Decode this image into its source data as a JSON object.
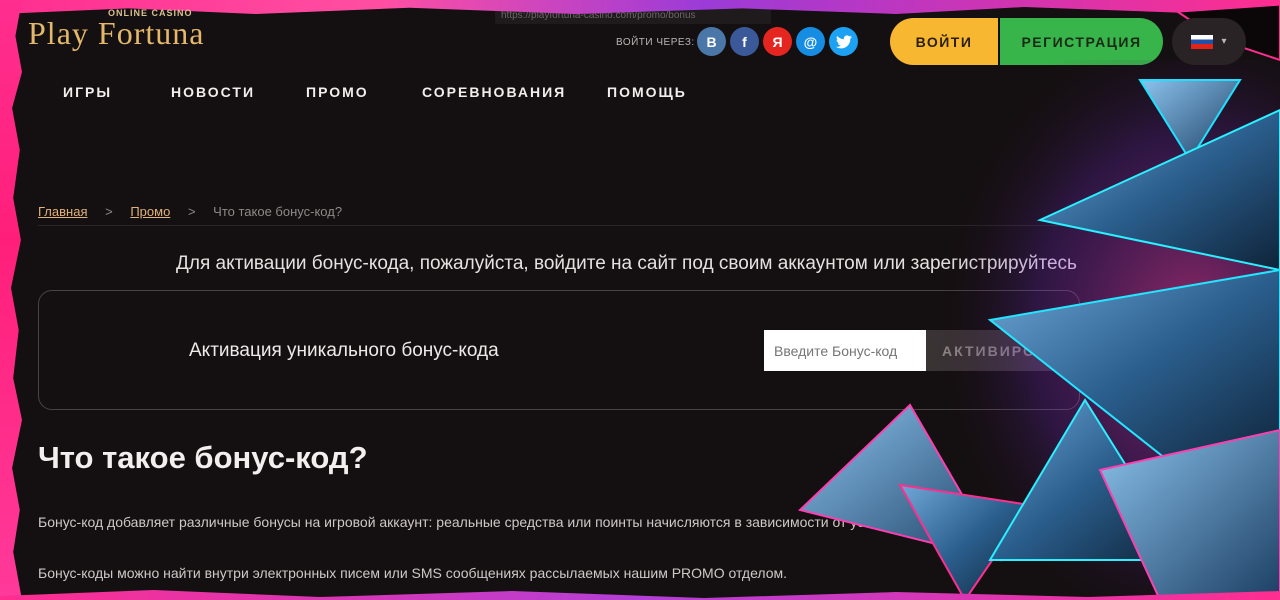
{
  "header": {
    "logo_sub": "ONLINE CASINO",
    "logo_main": "Play Fortuna",
    "url_text": "https://playfortuna-casino.com/promo/bonus",
    "login_via": "ВОЙТИ ЧЕРЕЗ:",
    "socials": [
      {
        "label": "B",
        "icon": "vk-icon"
      },
      {
        "label": "f",
        "icon": "facebook-icon"
      },
      {
        "label": "Я",
        "icon": "yandex-icon"
      },
      {
        "label": "@",
        "icon": "mailru-icon"
      },
      {
        "label": "🐦",
        "icon": "twitter-icon"
      }
    ],
    "login_button": "ВОЙТИ",
    "register_button": "РЕГИСТРАЦИЯ",
    "lang_chevron": "▾"
  },
  "nav": {
    "items": [
      "ИГРЫ",
      "НОВОСТИ",
      "ПРОМО",
      "СОРЕВНОВАНИЯ",
      "ПОМОЩЬ"
    ]
  },
  "breadcrumb": {
    "home": "Главная",
    "sep": ">",
    "promo": "Промо",
    "current": "Что такое бонус-код?"
  },
  "main": {
    "notice": "Для активации бонус-кода, пожалуйста, войдите на сайт под своим аккаунтом или зарегистрируйтесь",
    "promo_label": "Активация уникального бонус-кода",
    "promo_placeholder": "Введите Бонус-код",
    "promo_button": "АКТИВИРОВАТЬ",
    "title": "Что такое бонус-код?",
    "para1": "Бонус-код добавляет различные бонусы на игровой аккаунт: реальные средства или поинты начисляются в зависимости от условий акции.",
    "para2": "Бонус-коды можно найти внутри электронных писем или SMS сообщениях рассылаемых нашим PROMO отделом."
  },
  "colors": {
    "login": "#f7b731",
    "register": "#38b54a",
    "accent_pink": "#ff2e8f",
    "link": "#e0b27a"
  }
}
